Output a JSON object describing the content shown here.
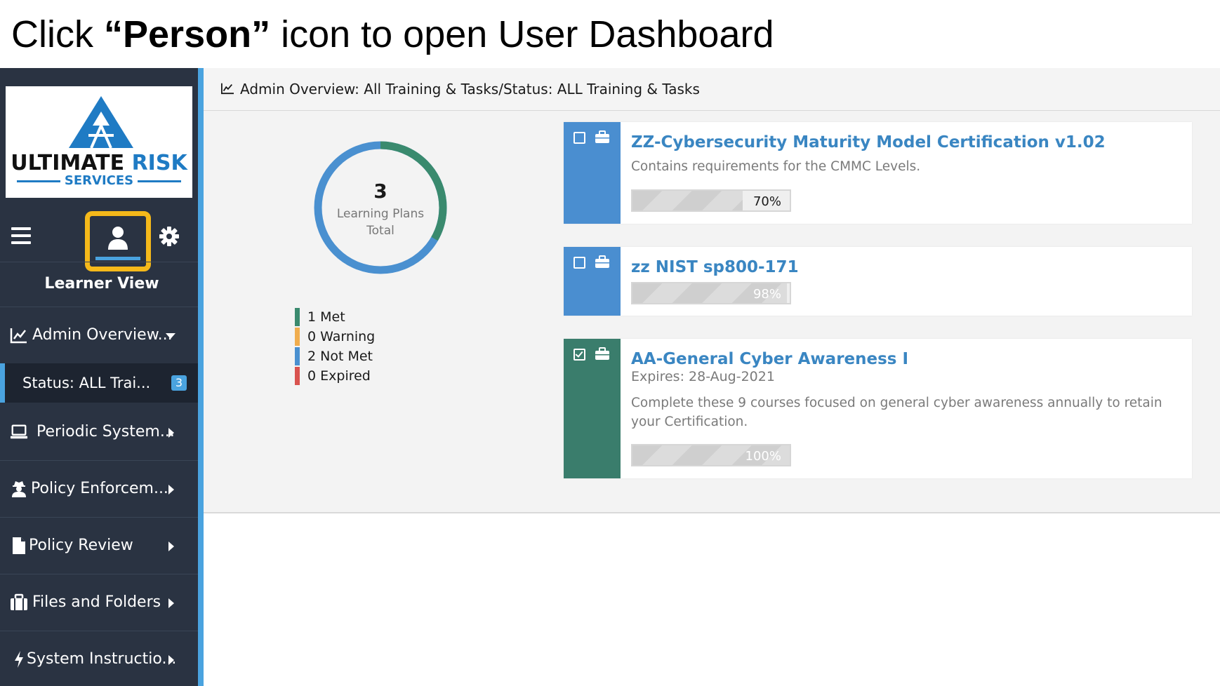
{
  "slide": {
    "title_prefix": "Click ",
    "title_bold": "“Person”",
    "title_suffix": " icon to open User Dashboard"
  },
  "logo": {
    "word1": "ULTIMATE",
    "word2": "RISK",
    "sub": "SERVICES",
    "brand_color": "#1f7bc4"
  },
  "sidebar": {
    "learner_view": "Learner View",
    "highlight_color": "#f5b91a",
    "items": [
      {
        "label": "Admin Overview...",
        "icon": "line-chart-icon",
        "expanded": true
      },
      {
        "label": "Periodic System...",
        "icon": "laptop-icon"
      },
      {
        "label": "Policy Enforcem...",
        "icon": "user-secret-icon"
      },
      {
        "label": "Policy Review",
        "icon": "document-icon"
      },
      {
        "label": "Files and Folders",
        "icon": "briefcase-icon"
      },
      {
        "label": "System Instructio...",
        "icon": "bolt-icon"
      }
    ],
    "active_sub": {
      "label": "Status: ALL Trai...",
      "count": "3"
    }
  },
  "header": {
    "breadcrumb": "Admin Overview: All Training & Tasks/Status: ALL Training & Tasks",
    "icon": "line-chart-icon"
  },
  "summary": {
    "total": "3",
    "caption_line1": "Learning Plans",
    "caption_line2": "Total",
    "legend": [
      {
        "label": "1 Met",
        "count": 1,
        "color": "#3a8a6e"
      },
      {
        "label": "0 Warning",
        "count": 0,
        "color": "#f0ad4e"
      },
      {
        "label": "2 Not Met",
        "count": 2,
        "color": "#4a90d0"
      },
      {
        "label": "0 Expired",
        "count": 0,
        "color": "#d9534f"
      }
    ]
  },
  "plans": [
    {
      "title": "ZZ-Cybersecurity Maturity Model Certification v1.02",
      "description": "Contains requirements for the CMMC Levels.",
      "expires": "",
      "progress": 0.7,
      "progress_label": "70%",
      "checked": false,
      "status_color": "#4a8ed0"
    },
    {
      "title": "zz NIST sp800-171",
      "description": "",
      "expires": "",
      "progress": 0.98,
      "progress_label": "98%",
      "checked": false,
      "status_color": "#4a8ed0"
    },
    {
      "title": "AA-General Cyber Awareness I",
      "description": "Complete these 9 courses focused on general cyber awareness annually to retain your Certification.",
      "expires": "Expires: 28-Aug-2021",
      "progress": 1.0,
      "progress_label": "100%",
      "checked": true,
      "status_color": "#3a7d6c"
    }
  ]
}
